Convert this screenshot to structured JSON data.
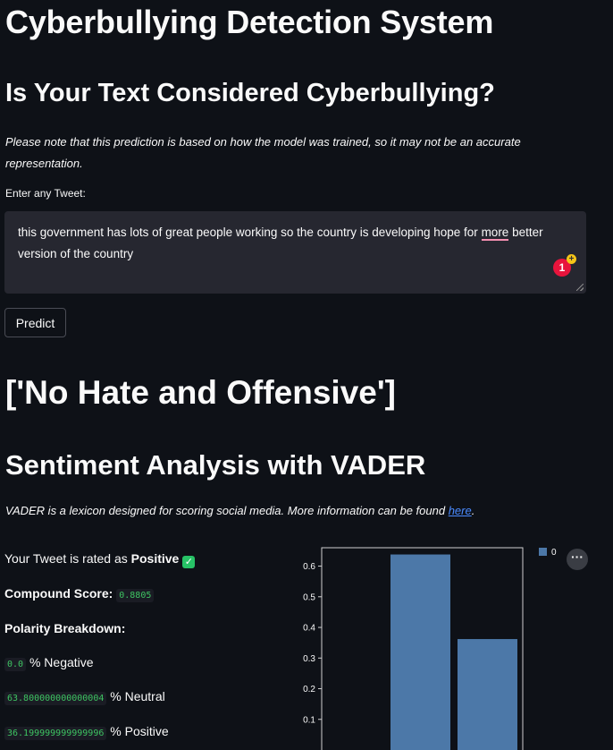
{
  "app_title": "Cyberbullying Detection System",
  "question_title": "Is Your Text Considered Cyberbullying?",
  "disclaimer": "Please note that this prediction is based on how the model was trained, so it may not be an accurate representation.",
  "input": {
    "label": "Enter any Tweet:",
    "text_before": "this government has  lots of great people working so the country is developing hope for ",
    "text_flagged": "more",
    "text_after": " better version of the country",
    "grammar_count": "1"
  },
  "predict_button": "Predict",
  "prediction": "['No Hate and Offensive']",
  "sentiment": {
    "title": "Sentiment Analysis with VADER",
    "note_text": "VADER is a lexicon designed for scoring social media. More information can be found ",
    "note_link": "here",
    "note_end": ".",
    "rating_prefix": "Your Tweet is rated as ",
    "rating": "Positive",
    "compound_label": "Compound Score:",
    "compound_value": "0.8805",
    "breakdown_label": "Polarity Breakdown:",
    "negative_value": "0.0",
    "negative_label": "% Negative",
    "neutral_value": "63.800000000000004",
    "neutral_label": "% Neutral",
    "positive_value": "36.199999999999996",
    "positive_label": "% Positive"
  },
  "chart_data": {
    "type": "bar",
    "categories": [
      "",
      "",
      ""
    ],
    "series": [
      {
        "name": "0",
        "values": [
          0.0,
          0.638,
          0.362
        ]
      }
    ],
    "yticks": [
      "0.1",
      "0.2",
      "0.3",
      "0.4",
      "0.5",
      "0.6"
    ],
    "ylim": [
      0,
      0.66
    ],
    "color": "#4c78a8",
    "legend": "top-right",
    "grid": false
  },
  "menu_icon": "more-horizontal-icon"
}
